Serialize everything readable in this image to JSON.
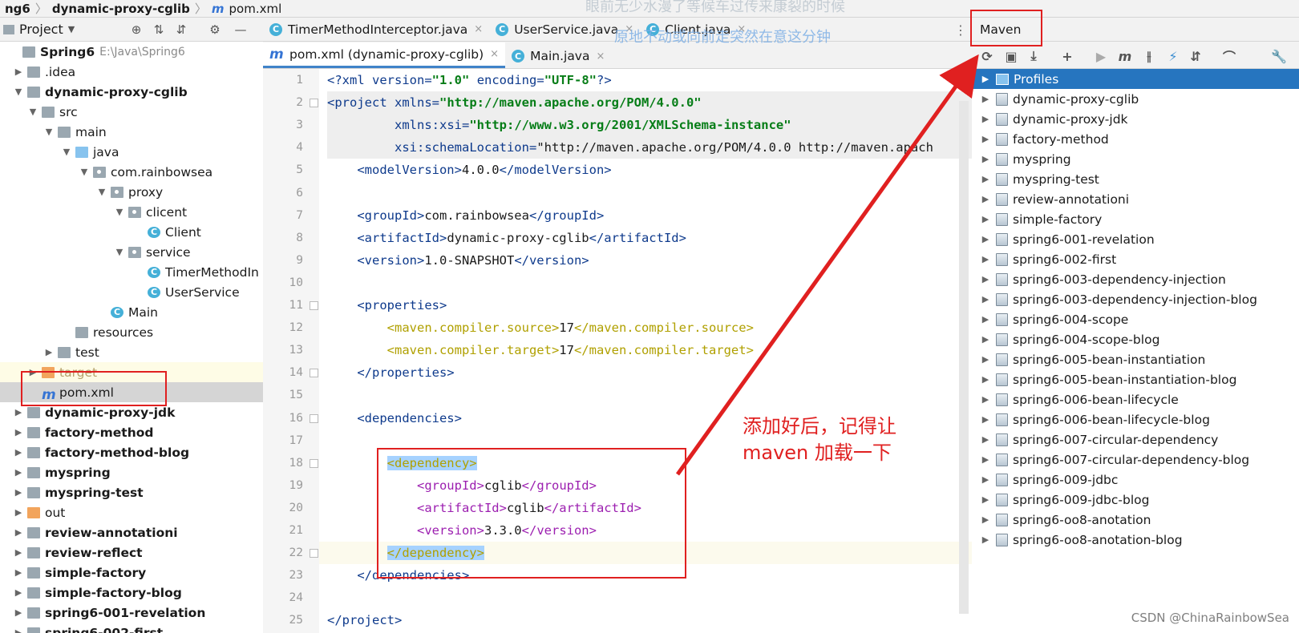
{
  "breadcrumb": {
    "items": [
      "ng6",
      "dynamic-proxy-cglib"
    ],
    "file": "pom.xml",
    "file_icon": "m"
  },
  "project_panel": {
    "title": "Project"
  },
  "tree": [
    {
      "label": "Spring6",
      "path": "E:\\Java\\Spring6",
      "icon": "folder",
      "arrow": "",
      "bold": true
    },
    {
      "label": ".idea",
      "icon": "folder",
      "arrow": "▶"
    },
    {
      "label": "dynamic-proxy-cglib",
      "icon": "folder",
      "arrow": "▼",
      "bold": true
    },
    {
      "label": "src",
      "icon": "folder",
      "arrow": "▼"
    },
    {
      "label": "main",
      "icon": "folder",
      "arrow": "▼"
    },
    {
      "label": "java",
      "icon": "folder-blue",
      "arrow": "▼"
    },
    {
      "label": "com.rainbowsea",
      "icon": "package",
      "arrow": "▼"
    },
    {
      "label": "proxy",
      "icon": "package",
      "arrow": "▼"
    },
    {
      "label": "clicent",
      "icon": "package",
      "arrow": "▼"
    },
    {
      "label": "Client",
      "icon": "class",
      "arrow": ""
    },
    {
      "label": "service",
      "icon": "package",
      "arrow": "▼"
    },
    {
      "label": "TimerMethodIn",
      "icon": "class",
      "arrow": ""
    },
    {
      "label": "UserService",
      "icon": "class",
      "arrow": ""
    },
    {
      "label": "Main",
      "icon": "class",
      "arrow": ""
    },
    {
      "label": "resources",
      "icon": "folder",
      "arrow": ""
    },
    {
      "label": "test",
      "icon": "folder",
      "arrow": "▶"
    },
    {
      "label": "target",
      "icon": "folder-orange",
      "arrow": "▶"
    },
    {
      "label": "pom.xml",
      "icon": "m",
      "arrow": ""
    },
    {
      "label": "dynamic-proxy-jdk",
      "icon": "folder",
      "arrow": "▶",
      "bold": true
    },
    {
      "label": "factory-method",
      "icon": "folder",
      "arrow": "▶",
      "bold": true
    },
    {
      "label": "factory-method-blog",
      "icon": "folder",
      "arrow": "▶",
      "bold": true
    },
    {
      "label": "myspring",
      "icon": "folder",
      "arrow": "▶",
      "bold": true
    },
    {
      "label": "myspring-test",
      "icon": "folder",
      "arrow": "▶",
      "bold": true
    },
    {
      "label": "out",
      "icon": "folder-orange",
      "arrow": "▶"
    },
    {
      "label": "review-annotationi",
      "icon": "folder",
      "arrow": "▶",
      "bold": true
    },
    {
      "label": "review-reflect",
      "icon": "folder",
      "arrow": "▶",
      "bold": true
    },
    {
      "label": "simple-factory",
      "icon": "folder",
      "arrow": "▶",
      "bold": true
    },
    {
      "label": "simple-factory-blog",
      "icon": "folder",
      "arrow": "▶",
      "bold": true
    },
    {
      "label": "spring6-001-revelation",
      "icon": "folder",
      "arrow": "▶",
      "bold": true
    },
    {
      "label": "spring6-002-first",
      "icon": "folder",
      "arrow": "▶",
      "bold": true
    }
  ],
  "tabs_row1": [
    {
      "label": "TimerMethodInterceptor.java",
      "icon": "C",
      "close": "×"
    },
    {
      "label": "UserService.java",
      "icon": "C",
      "close": "×"
    },
    {
      "label": "Client.java",
      "icon": "C",
      "close": "×"
    }
  ],
  "tabs_row2": [
    {
      "label": "pom.xml (dynamic-proxy-cglib)",
      "icon": "m",
      "close": "×",
      "active": true
    },
    {
      "label": "Main.java",
      "icon": "C",
      "close": "×"
    }
  ],
  "watermarks": {
    "top": "眼前无少水漫了等候车过传来康裂的时候",
    "mid": "原地不动或向前走突然在意这分钟"
  },
  "code_lines": [
    {
      "n": "1",
      "text": "<?xml version=\"1.0\" encoding=\"UTF-8\"?>"
    },
    {
      "n": "2",
      "text": "<project xmlns=\"http://maven.apache.org/POM/4.0.0\""
    },
    {
      "n": "3",
      "text": "         xmlns:xsi=\"http://www.w3.org/2001/XMLSchema-instance\""
    },
    {
      "n": "4",
      "text": "         xsi:schemaLocation=\"http://maven.apache.org/POM/4.0.0 http://maven.apach"
    },
    {
      "n": "5",
      "text": "    <modelVersion>4.0.0</modelVersion>"
    },
    {
      "n": "6",
      "text": ""
    },
    {
      "n": "7",
      "text": "    <groupId>com.rainbowsea</groupId>"
    },
    {
      "n": "8",
      "text": "    <artifactId>dynamic-proxy-cglib</artifactId>"
    },
    {
      "n": "9",
      "text": "    <version>1.0-SNAPSHOT</version>"
    },
    {
      "n": "10",
      "text": ""
    },
    {
      "n": "11",
      "text": "    <properties>"
    },
    {
      "n": "12",
      "text": "        <maven.compiler.source>17</maven.compiler.source>"
    },
    {
      "n": "13",
      "text": "        <maven.compiler.target>17</maven.compiler.target>"
    },
    {
      "n": "14",
      "text": "    </properties>"
    },
    {
      "n": "15",
      "text": ""
    },
    {
      "n": "16",
      "text": "    <dependencies>"
    },
    {
      "n": "17",
      "text": ""
    },
    {
      "n": "18",
      "text": "        <dependency>"
    },
    {
      "n": "19",
      "text": "            <groupId>cglib</groupId>"
    },
    {
      "n": "20",
      "text": "            <artifactId>cglib</artifactId>"
    },
    {
      "n": "21",
      "text": "            <version>3.3.0</version>"
    },
    {
      "n": "22",
      "text": "        </dependency>"
    },
    {
      "n": "23",
      "text": "    </dependencies>"
    },
    {
      "n": "24",
      "text": ""
    },
    {
      "n": "25",
      "text": "</project>"
    }
  ],
  "maven_panel": {
    "title": "Maven",
    "projects": [
      "Profiles",
      "dynamic-proxy-cglib",
      "dynamic-proxy-jdk",
      "factory-method",
      "myspring",
      "myspring-test",
      "review-annotationi",
      "simple-factory",
      "spring6-001-revelation",
      "spring6-002-first",
      "spring6-003-dependency-injection",
      "spring6-003-dependency-injection-blog",
      "spring6-004-scope",
      "spring6-004-scope-blog",
      "spring6-005-bean-instantiation",
      "spring6-005-bean-instantiation-blog",
      "spring6-006-bean-lifecycle",
      "spring6-006-bean-lifecycle-blog",
      "spring6-007-circular-dependency",
      "spring6-007-circular-dependency-blog",
      "spring6-009-jdbc",
      "spring6-009-jdbc-blog",
      "spring6-oo8-anotation",
      "spring6-oo8-anotation-blog"
    ]
  },
  "annotation": {
    "line1": "添加好后，记得让",
    "line2": "maven 加载一下",
    "color": "#e02020"
  },
  "csdn_watermark": "CSDN @ChinaRainbowSea",
  "colors": {
    "selection": "#2675bf",
    "tab_underline": "#4083c9",
    "annotation_red": "#e02020"
  }
}
